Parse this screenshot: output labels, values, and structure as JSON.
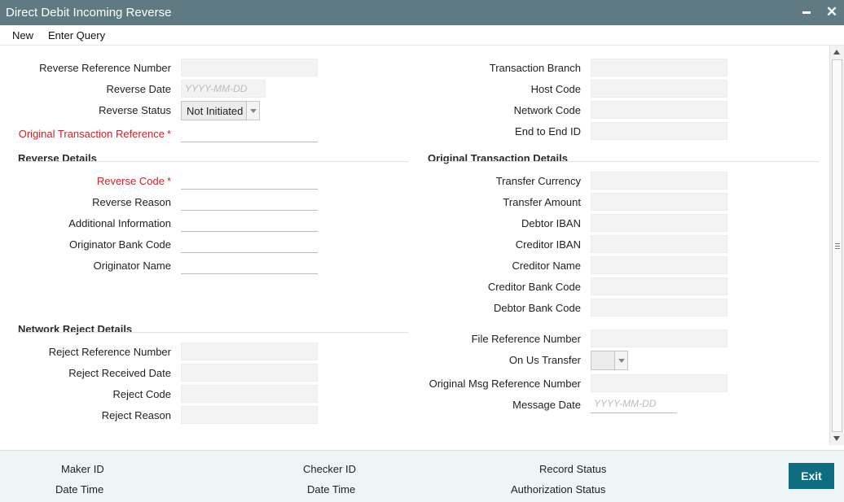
{
  "window": {
    "title": "Direct Debit Incoming Reverse",
    "minimize_icon": "minimize-icon",
    "close_icon": "close-icon",
    "close_glyph": "✕"
  },
  "menu": {
    "new_label": "New",
    "enter_query_label": "Enter Query"
  },
  "left_top": {
    "reverse_reference_number": {
      "label": "Reverse Reference Number",
      "value": ""
    },
    "reverse_date": {
      "label": "Reverse Date",
      "placeholder": "YYYY-MM-DD"
    },
    "reverse_status": {
      "label": "Reverse Status",
      "value": "Not Initiated"
    },
    "original_transaction_reference": {
      "label": "Original Transaction Reference",
      "required_mark": "*"
    }
  },
  "right_top": {
    "transaction_branch": {
      "label": "Transaction Branch"
    },
    "host_code": {
      "label": "Host Code"
    },
    "network_code": {
      "label": "Network Code"
    },
    "end_to_end_id": {
      "label": "End to End ID"
    }
  },
  "reverse_details": {
    "heading": "Reverse Details",
    "reverse_code": {
      "label": "Reverse Code",
      "required_mark": "*"
    },
    "reverse_reason": {
      "label": "Reverse Reason"
    },
    "additional_information": {
      "label": "Additional Information"
    },
    "originator_bank_code": {
      "label": "Originator Bank Code"
    },
    "originator_name": {
      "label": "Originator Name"
    }
  },
  "original_transaction_details": {
    "heading": "Original Transaction Details",
    "transfer_currency": {
      "label": "Transfer Currency"
    },
    "transfer_amount": {
      "label": "Transfer Amount"
    },
    "debtor_iban": {
      "label": "Debtor IBAN"
    },
    "creditor_iban": {
      "label": "Creditor IBAN"
    },
    "creditor_name": {
      "label": "Creditor Name"
    },
    "creditor_bank_code": {
      "label": "Creditor Bank Code"
    },
    "debtor_bank_code": {
      "label": "Debtor Bank Code"
    },
    "file_reference_number": {
      "label": "File Reference Number"
    },
    "on_us_transfer": {
      "label": "On Us Transfer",
      "value": ""
    },
    "original_msg_reference_number": {
      "label": "Original Msg Reference Number"
    },
    "message_date": {
      "label": "Message Date",
      "placeholder": "YYYY-MM-DD"
    }
  },
  "network_reject_details": {
    "heading": "Network Reject Details",
    "reject_reference_number": {
      "label": "Reject Reference Number"
    },
    "reject_received_date": {
      "label": "Reject Received Date"
    },
    "reject_code": {
      "label": "Reject Code"
    },
    "reject_reason": {
      "label": "Reject Reason"
    }
  },
  "footer": {
    "maker_id": "Maker ID",
    "date_time_1": "Date Time",
    "checker_id": "Checker ID",
    "date_time_2": "Date Time",
    "record_status": "Record Status",
    "authorization_status": "Authorization Status",
    "exit_label": "Exit"
  }
}
